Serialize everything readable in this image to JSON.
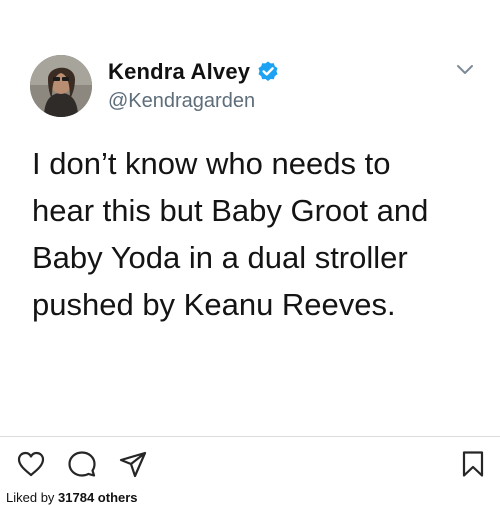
{
  "author": {
    "display_name": "Kendra Alvey",
    "handle": "@Kendragarden",
    "verified": true
  },
  "tweet": {
    "lines": [
      "I don’t know who needs to",
      "hear this but Baby Groot and",
      "Baby Yoda in a dual stroller",
      "pushed by Keanu Reeves."
    ]
  },
  "actions": {
    "icons": [
      "heart-icon",
      "comment-icon",
      "share-icon",
      "bookmark-icon"
    ]
  },
  "likes": {
    "prefix": "Liked by",
    "count": "31784 others"
  },
  "colors": {
    "verified_blue": "#1da1f2",
    "handle_gray": "#5d6d7a",
    "text": "#141414"
  }
}
